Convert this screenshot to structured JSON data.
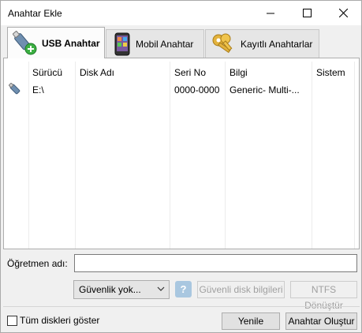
{
  "window": {
    "title": "Anahtar Ekle"
  },
  "icons": {
    "minimize": "minimize-icon",
    "maximize": "maximize-icon",
    "close": "close-icon",
    "usb": "usb-key-icon",
    "mobile": "mobile-phone-icon",
    "saved_keys": "keys-icon",
    "usb_row": "usb-drive-icon",
    "dropdown": "chevron-down-icon",
    "help": "help-icon"
  },
  "tabs": [
    {
      "label": "USB Anahtar",
      "active": true
    },
    {
      "label": "Mobil Anahtar",
      "active": false
    },
    {
      "label": "Kayıtlı Anahtarlar",
      "active": false
    }
  ],
  "table": {
    "columns": [
      "Sürücü",
      "Disk Adı",
      "Seri No",
      "Bilgi",
      "Sistem"
    ],
    "rows": [
      {
        "drive": "E:\\",
        "disk_name": "",
        "serial": "0000-0000",
        "info": "Generic- Multi-...",
        "system": ""
      }
    ]
  },
  "form": {
    "teacher_label": "Öğretmen adı:",
    "teacher_value": "",
    "security_selected": "Güvenlik yok...",
    "help_glyph": "?",
    "secure_disk_info_label": "Güvenli disk bilgileri",
    "ntfs_convert_label": "NTFS Dönüştür"
  },
  "footer": {
    "show_all_label": "Tüm diskleri göster",
    "show_all_checked": false,
    "refresh_label": "Yenile",
    "create_key_label": "Anahtar Oluştur"
  },
  "colors": {
    "help_button": "#a9c7e0",
    "usb_badge": "#3cb043",
    "keys": "#e3b23c"
  }
}
